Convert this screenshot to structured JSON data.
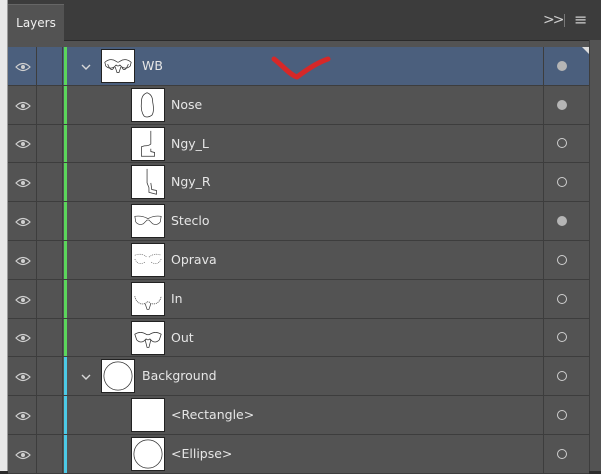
{
  "panel": {
    "tab_label": "Layers",
    "collapse_icon": ">>",
    "menu_icon": "hamburger-menu-icon"
  },
  "layers": [
    {
      "name": "WB",
      "level": 0,
      "expanded": true,
      "selected": true,
      "visible": true,
      "target_filled": true,
      "color": "#5bd65b",
      "thumb": "glasses-front-icon"
    },
    {
      "name": "Nose",
      "level": 1,
      "visible": true,
      "target_filled": true,
      "color": "#5bd65b",
      "thumb": "nose-shape-icon"
    },
    {
      "name": "Ngy_L",
      "level": 1,
      "visible": true,
      "target_filled": false,
      "color": "#5bd65b",
      "thumb": "temple-left-icon"
    },
    {
      "name": "Ngy_R",
      "level": 1,
      "visible": true,
      "target_filled": false,
      "color": "#5bd65b",
      "thumb": "temple-right-icon"
    },
    {
      "name": "Steclo",
      "level": 1,
      "visible": true,
      "target_filled": true,
      "color": "#5bd65b",
      "thumb": "lenses-icon"
    },
    {
      "name": "Oprava",
      "level": 1,
      "visible": true,
      "target_filled": false,
      "color": "#5bd65b",
      "thumb": "frame-icon"
    },
    {
      "name": "In",
      "level": 1,
      "visible": true,
      "target_filled": false,
      "color": "#5bd65b",
      "thumb": "frame-inner-icon"
    },
    {
      "name": "Out",
      "level": 1,
      "visible": true,
      "target_filled": false,
      "color": "#5bd65b",
      "thumb": "frame-outer-icon"
    },
    {
      "name": "Background",
      "level": 0,
      "expanded": true,
      "visible": true,
      "target_filled": false,
      "color": "#4cc9e6",
      "thumb": "circle-icon"
    },
    {
      "name": "<Rectangle>",
      "level": 1,
      "visible": true,
      "target_filled": false,
      "color": "#4cc9e6",
      "thumb": "blank-icon"
    },
    {
      "name": "<Ellipse>",
      "level": 1,
      "visible": true,
      "target_filled": false,
      "color": "#4cc9e6",
      "thumb": "circle-icon"
    }
  ],
  "annotation": {
    "color": "#d62828",
    "icon": "red-checkmark-annotation"
  }
}
